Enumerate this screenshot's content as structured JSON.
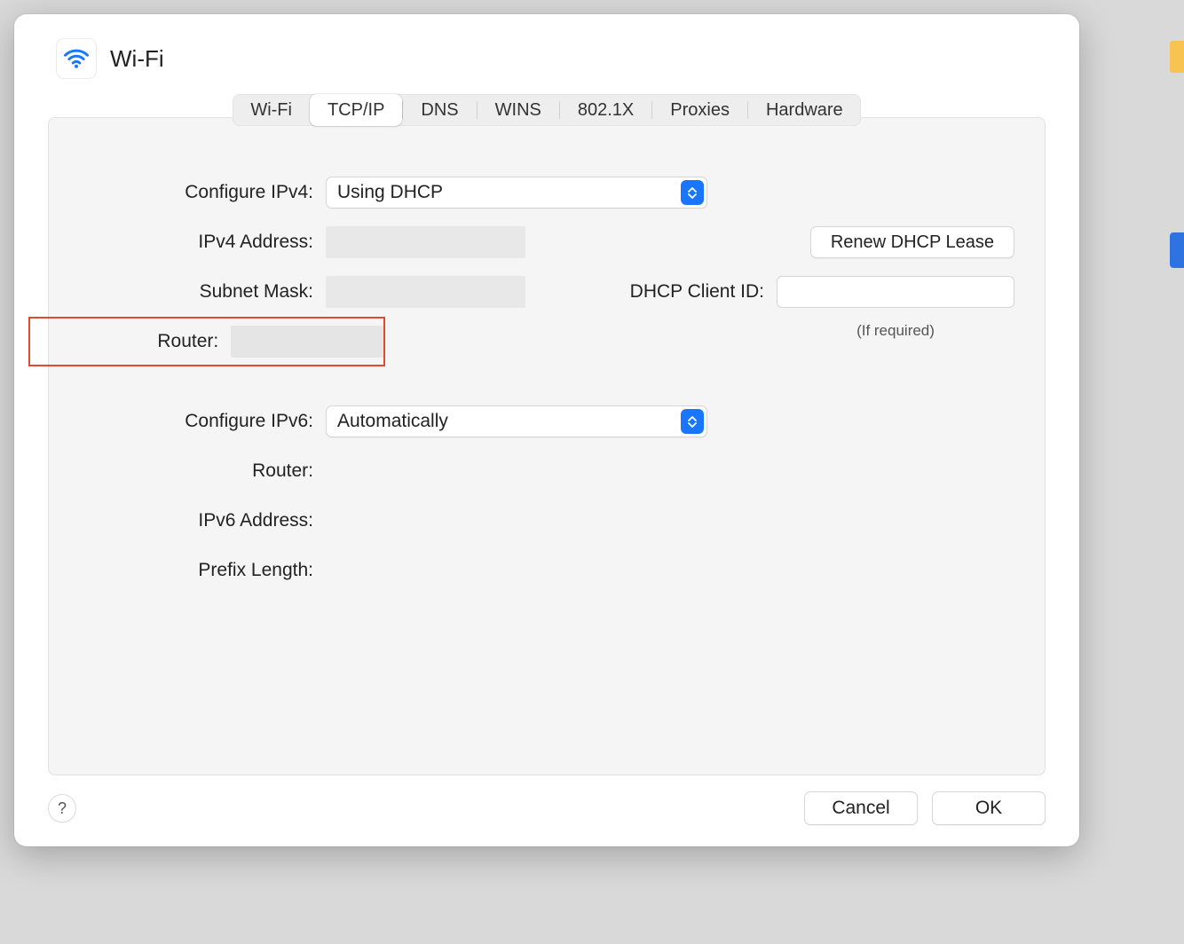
{
  "header": {
    "title": "Wi-Fi",
    "icon": "wifi-icon"
  },
  "tabs": [
    {
      "id": "wifi",
      "label": "Wi-Fi",
      "active": false
    },
    {
      "id": "tcpip",
      "label": "TCP/IP",
      "active": true
    },
    {
      "id": "dns",
      "label": "DNS",
      "active": false
    },
    {
      "id": "wins",
      "label": "WINS",
      "active": false
    },
    {
      "id": "8021x",
      "label": "802.1X",
      "active": false
    },
    {
      "id": "proxies",
      "label": "Proxies",
      "active": false
    },
    {
      "id": "hardware",
      "label": "Hardware",
      "active": false
    }
  ],
  "form": {
    "configure_ipv4_label": "Configure IPv4:",
    "configure_ipv4_value": "Using DHCP",
    "ipv4_address_label": "IPv4 Address:",
    "ipv4_address_value": "",
    "subnet_mask_label": "Subnet Mask:",
    "subnet_mask_value": "",
    "router4_label": "Router:",
    "router4_value": "",
    "renew_lease_label": "Renew DHCP Lease",
    "dhcp_client_id_label": "DHCP Client ID:",
    "dhcp_client_id_value": "",
    "dhcp_client_id_hint": "(If required)",
    "configure_ipv6_label": "Configure IPv6:",
    "configure_ipv6_value": "Automatically",
    "router6_label": "Router:",
    "router6_value": "",
    "ipv6_address_label": "IPv6 Address:",
    "ipv6_address_value": "",
    "prefix_length_label": "Prefix Length:",
    "prefix_length_value": ""
  },
  "footer": {
    "help_label": "?",
    "cancel_label": "Cancel",
    "ok_label": "OK"
  },
  "colors": {
    "accent": "#1976ff",
    "highlight": "#e64a2e"
  }
}
